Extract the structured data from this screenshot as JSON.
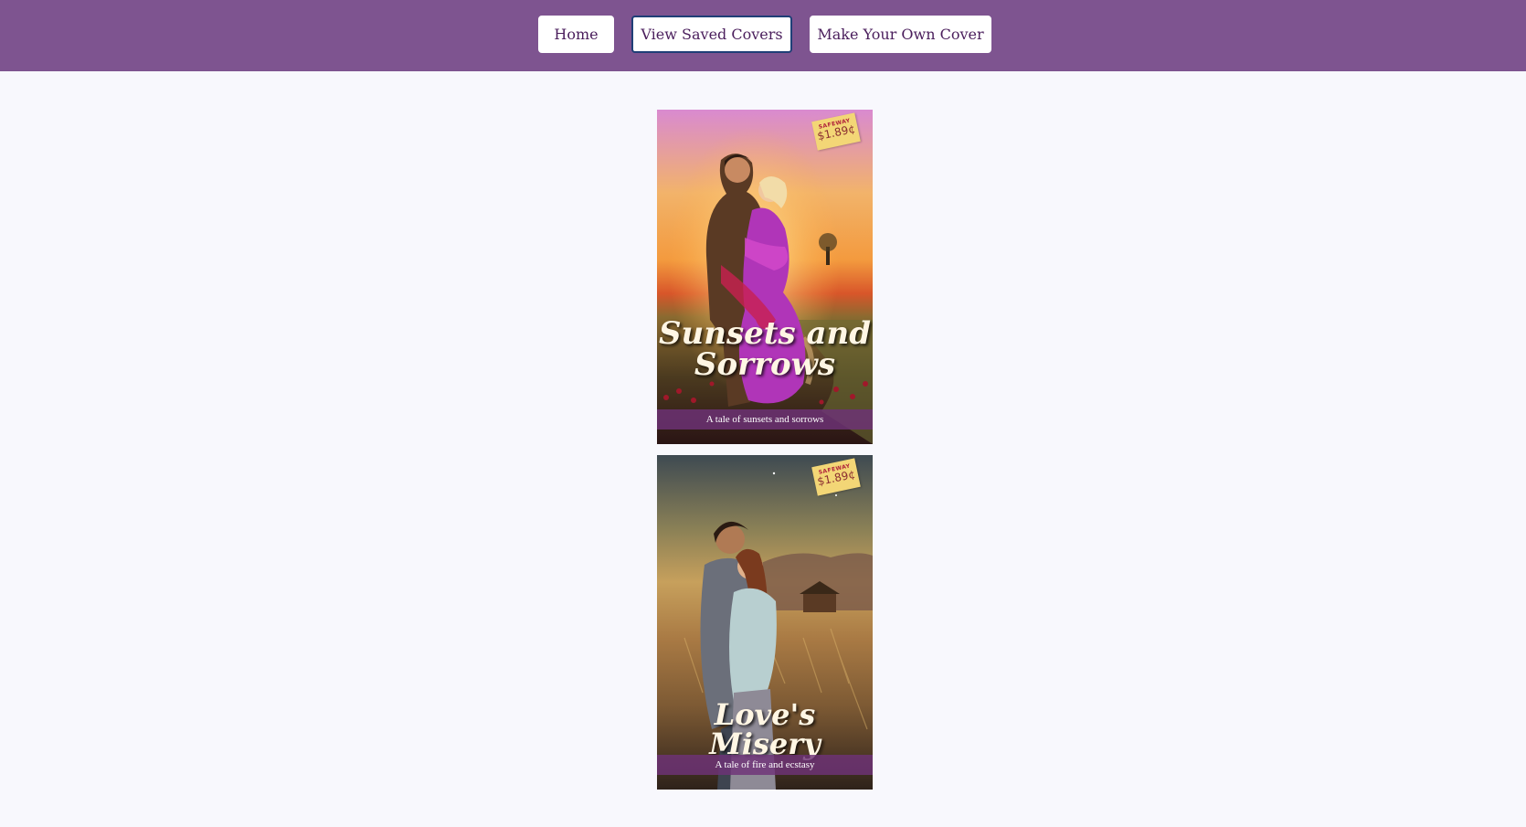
{
  "nav": {
    "home_label": "Home",
    "saved_label": "View Saved Covers",
    "make_label": "Make Your Own Cover"
  },
  "covers": [
    {
      "title": "Sunsets and Sorrows",
      "tagline": "A tale of sunsets and sorrows",
      "price_store": "SAFEWAY",
      "price": "$1.89¢"
    },
    {
      "title": "Love's Misery",
      "tagline": "A tale of fire and ecstasy",
      "price_store": "SAFEWAY",
      "price": "$1.89¢"
    }
  ],
  "colors": {
    "header": "#7e5490",
    "background": "#f8f8fd",
    "button_text": "#4a1e5c",
    "focus_ring": "#1f3f77"
  }
}
